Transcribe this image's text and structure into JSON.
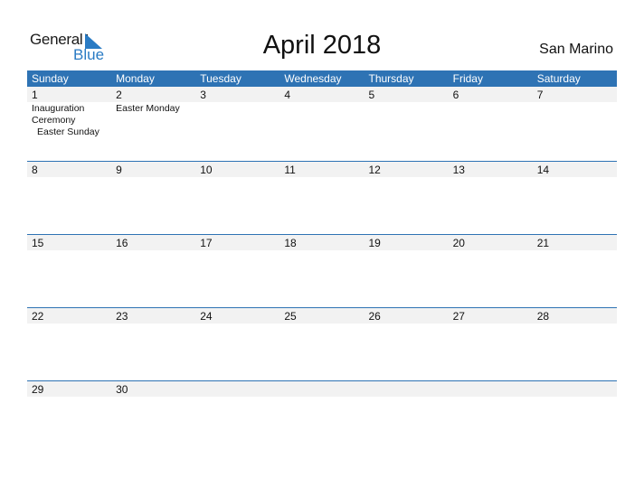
{
  "logo": {
    "word1": "General",
    "word2": "Blue"
  },
  "title": "April 2018",
  "country": "San Marino",
  "colors": {
    "header_bg": "#2e73b4",
    "logo_blue": "#2a7bc4",
    "date_strip": "#f2f2f2"
  },
  "days": [
    "Sunday",
    "Monday",
    "Tuesday",
    "Wednesday",
    "Thursday",
    "Friday",
    "Saturday"
  ],
  "weeks": [
    {
      "dates": [
        "1",
        "2",
        "3",
        "4",
        "5",
        "6",
        "7"
      ],
      "events": [
        [
          "Inauguration Ceremony",
          "Easter Sunday"
        ],
        [
          "Easter Monday"
        ],
        [],
        [],
        [],
        [],
        []
      ]
    },
    {
      "dates": [
        "8",
        "9",
        "10",
        "11",
        "12",
        "13",
        "14"
      ],
      "events": [
        [],
        [],
        [],
        [],
        [],
        [],
        []
      ]
    },
    {
      "dates": [
        "15",
        "16",
        "17",
        "18",
        "19",
        "20",
        "21"
      ],
      "events": [
        [],
        [],
        [],
        [],
        [],
        [],
        []
      ]
    },
    {
      "dates": [
        "22",
        "23",
        "24",
        "25",
        "26",
        "27",
        "28"
      ],
      "events": [
        [],
        [],
        [],
        [],
        [],
        [],
        []
      ]
    },
    {
      "dates": [
        "29",
        "30",
        "",
        "",
        "",
        "",
        ""
      ],
      "events": [
        [],
        [],
        [],
        [],
        [],
        [],
        []
      ]
    }
  ]
}
